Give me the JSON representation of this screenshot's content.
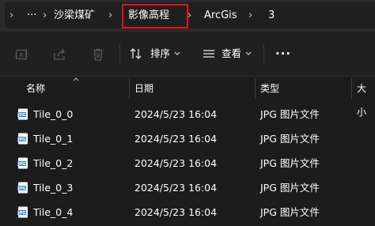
{
  "breadcrumb": {
    "more": "···",
    "items": [
      "沙梁煤矿",
      "影像高程",
      "ArcGis",
      "3"
    ],
    "separator": "›"
  },
  "toolbar": {
    "sort_label": "排序",
    "view_label": "查看",
    "more": "···"
  },
  "columns": {
    "name": "名称",
    "date": "日期",
    "type": "类型",
    "size": "大小"
  },
  "files": [
    {
      "name": "Tile_0_0",
      "date": "2024/5/23 16:04",
      "type": "JPG 图片文件"
    },
    {
      "name": "Tile_0_1",
      "date": "2024/5/23 16:04",
      "type": "JPG 图片文件"
    },
    {
      "name": "Tile_0_2",
      "date": "2024/5/23 16:04",
      "type": "JPG 图片文件"
    },
    {
      "name": "Tile_0_3",
      "date": "2024/5/23 16:04",
      "type": "JPG 图片文件"
    },
    {
      "name": "Tile_0_4",
      "date": "2024/5/23 16:04",
      "type": "JPG 图片文件"
    }
  ],
  "colors": {
    "highlight": "#e8101c",
    "accent": "#3b8bd6"
  }
}
